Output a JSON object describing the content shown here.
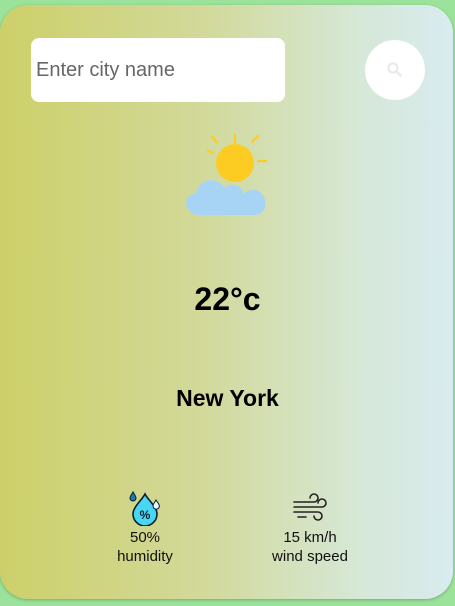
{
  "search": {
    "placeholder": "Enter city name",
    "button_icon": "search-icon"
  },
  "weather": {
    "icon": "partly-cloudy-icon",
    "temperature": "22°c",
    "city": "New York"
  },
  "stats": {
    "humidity": {
      "icon": "humidity-icon",
      "value": "50%",
      "label": "humidity"
    },
    "wind": {
      "icon": "wind-icon",
      "value": "15 km/h",
      "label": "wind speed"
    }
  },
  "colors": {
    "background": "#9be39a",
    "gradient_left": "#cdd069",
    "gradient_right": "#d8ebef",
    "sun": "#fdcc23",
    "cloud": "#a7d3f4"
  }
}
